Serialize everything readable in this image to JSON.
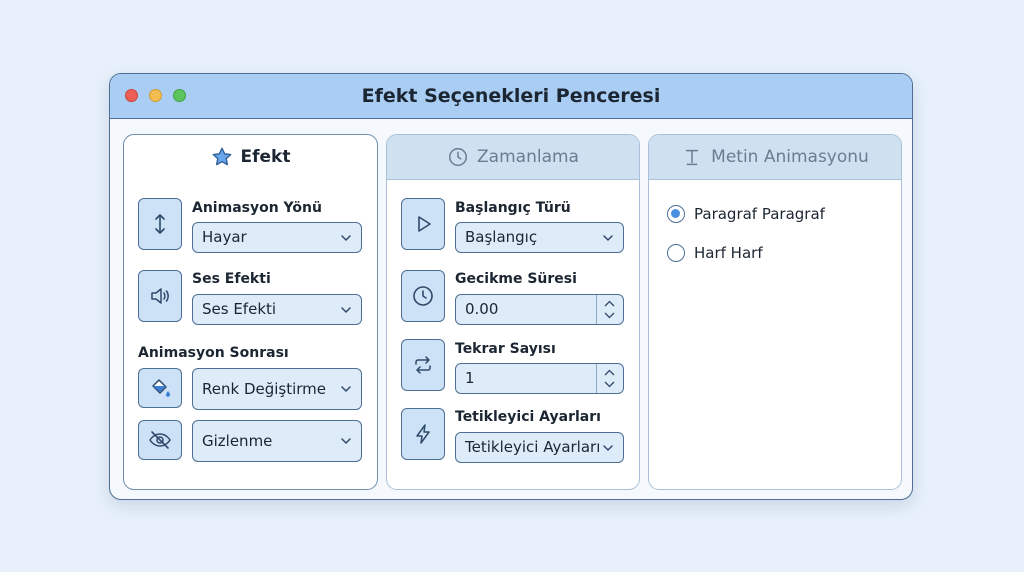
{
  "window": {
    "title": "Efekt Seçenekleri Penceresi"
  },
  "tabs": [
    {
      "label": "Efekt",
      "icon": "star-icon",
      "active": true
    },
    {
      "label": "Zamanlama",
      "icon": "clock-icon",
      "active": false
    },
    {
      "label": "Metin Animasyonu",
      "icon": "text-cursor-icon",
      "active": false
    }
  ],
  "effect": {
    "direction": {
      "label": "Animasyon Yönü",
      "value": "Hayar",
      "icon": "vertical-arrows-icon"
    },
    "sound": {
      "label": "Ses Efekti",
      "value": "Ses Efekti",
      "icon": "speaker-icon"
    },
    "after": {
      "label": "Animasyon Sonrası",
      "color": {
        "value": "Renk Değiştirme",
        "icon": "paint-bucket-icon"
      },
      "hide": {
        "value": "Gizlenme",
        "icon": "eye-off-icon"
      }
    }
  },
  "timing": {
    "start": {
      "label": "Başlangıç Türü",
      "value": "Başlangıç",
      "icon": "play-icon"
    },
    "delay": {
      "label": "Gecikme Süresi",
      "value": "0.00",
      "icon": "clock-icon"
    },
    "repeat": {
      "label": "Tekrar Sayısı",
      "value": "1",
      "icon": "repeat-icon"
    },
    "trigger": {
      "label": "Tetikleyici Ayarları",
      "value": "Tetikleyici Ayarları",
      "icon": "lightning-icon"
    }
  },
  "text_animation": {
    "options": [
      {
        "label": "Paragraf Paragraf",
        "selected": true
      },
      {
        "label": "Harf Harf",
        "selected": false
      }
    ]
  },
  "colors": {
    "accent": "#4a8fe0",
    "titlebar": "#a9cdf3",
    "border": "#4e6f93"
  }
}
